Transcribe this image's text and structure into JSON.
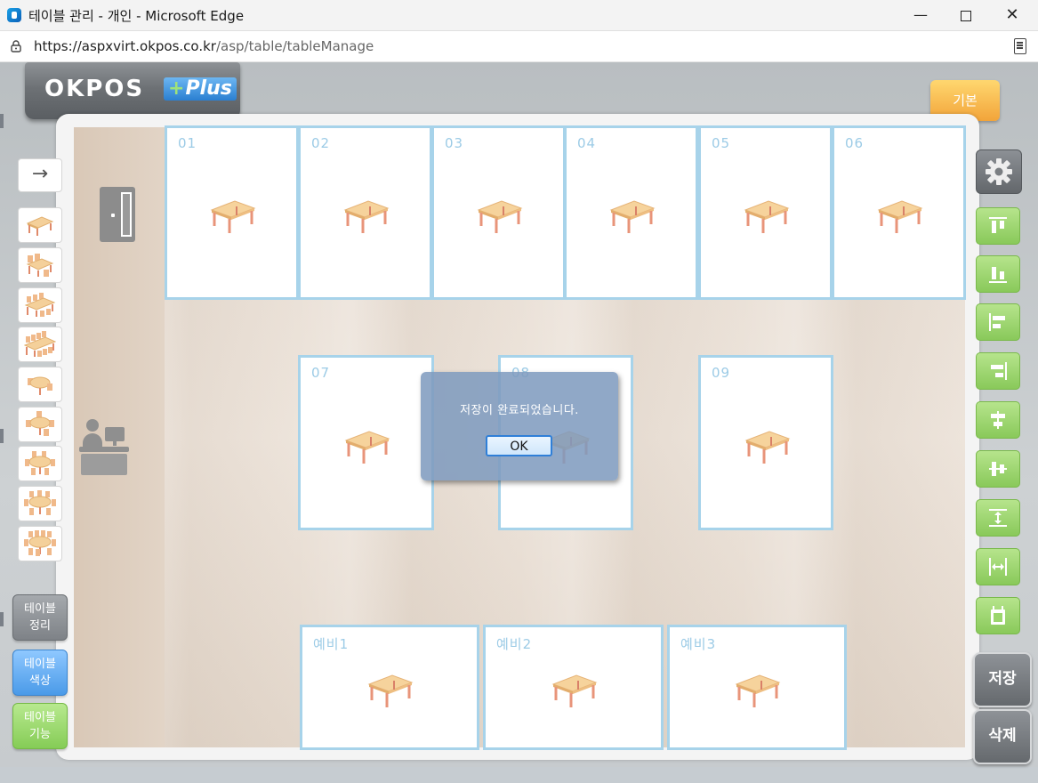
{
  "window": {
    "title": "테이블 관리 - 개인 - Microsoft Edge",
    "minimize_glyph": "—",
    "close_glyph": "✕"
  },
  "address_bar": {
    "url_host": "https://aspxvirt.okpos.co.kr",
    "url_path": "/asp/table/tableManage"
  },
  "app": {
    "logo_text": "OKPOS",
    "logo_plus": "Plus",
    "basic_button": "기본",
    "arrow_glyph": "→",
    "left_buttons": [
      {
        "line1": "테이블",
        "line2": "정리"
      },
      {
        "line1": "테이블",
        "line2": "색상"
      },
      {
        "line1": "테이블",
        "line2": "기능"
      }
    ],
    "save_button": "저장",
    "delete_button": "삭제"
  },
  "palette_icons": [
    "table-2-seat-icon",
    "table-4-seat-icon",
    "table-6-seat-icon",
    "table-8-seat-icon",
    "round-table-2-seat-icon",
    "round-table-4-seat-icon",
    "round-table-6-seat-icon",
    "round-table-8-seat-icon",
    "round-table-10-seat-icon"
  ],
  "toolbar_icons": [
    "align-top-icon",
    "align-bottom-icon",
    "align-left-icon",
    "align-right-icon",
    "align-vertical-center-icon",
    "align-horizontal-center-icon",
    "distribute-vertical-icon",
    "distribute-horizontal-icon",
    "same-size-icon"
  ],
  "tables": [
    "01",
    "02",
    "03",
    "04",
    "05",
    "06",
    "07",
    "08",
    "09",
    "예비1",
    "예비2",
    "예비3"
  ],
  "dialog": {
    "message": "저장이 완료되었습니다.",
    "ok_label": "OK"
  },
  "colors": {
    "table_border": "#a7d3ea",
    "table_number": "#9ccbe6",
    "basic_button": "#f5b547",
    "green_tool": "#9bd66d",
    "dialog_bg": "#7e9abe"
  }
}
